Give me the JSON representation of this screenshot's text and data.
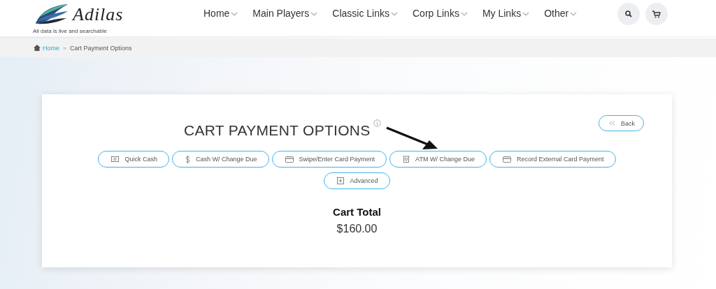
{
  "logo": {
    "name": "Adilas",
    "tagline": "All data is live and searchable"
  },
  "nav": [
    {
      "label": "Home"
    },
    {
      "label": "Main Players"
    },
    {
      "label": "Classic Links"
    },
    {
      "label": "Corp Links"
    },
    {
      "label": "My Links"
    },
    {
      "label": "Other"
    }
  ],
  "breadcrumb": {
    "home": "Home",
    "separator": "»",
    "current": "Cart Payment Options"
  },
  "page": {
    "title": "CART PAYMENT OPTIONS",
    "back": "Back"
  },
  "payment_buttons": [
    {
      "label": "Quick Cash",
      "kind": "cash"
    },
    {
      "label": "Cash W/ Change Due",
      "kind": "dollar"
    },
    {
      "label": "Swipe/Enter Card Payment",
      "kind": "card"
    },
    {
      "label": "ATM W/ Change Due",
      "kind": "atm"
    },
    {
      "label": "Record External Card Payment",
      "kind": "card"
    },
    {
      "label": "Advanced",
      "kind": "plus"
    }
  ],
  "cart": {
    "label": "Cart Total",
    "total": "$160.00"
  }
}
